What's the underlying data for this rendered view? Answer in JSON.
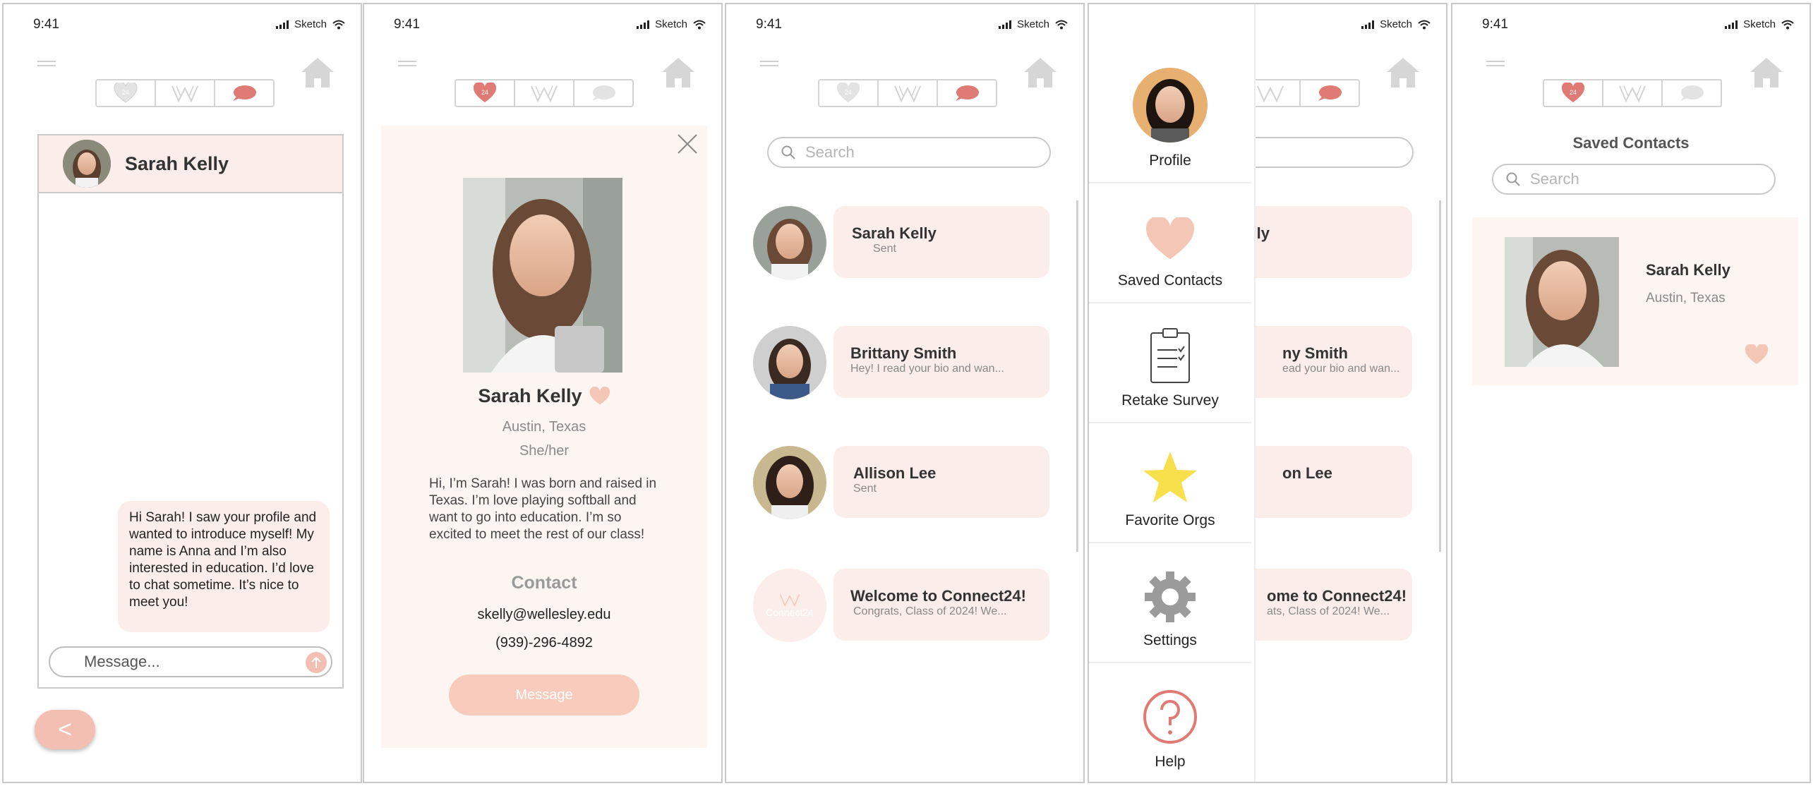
{
  "status": {
    "time": "9:41",
    "carrier": "Sketch"
  },
  "screen1": {
    "chat_name": "Sarah Kelly",
    "message": "Hi Sarah! I saw your profile and wanted to introduce myself! My name is Anna and I’m also interested in education. I’d love to chat sometime. It’s nice to meet you!",
    "input_placeholder": "Message...",
    "back_label": "<"
  },
  "screen2": {
    "name": "Sarah Kelly",
    "location": "Austin, Texas",
    "pronouns": "She/her",
    "bio": "Hi, I’m Sarah! I was born and raised in Texas. I’m love playing softball and want to go into education. I’m so excited to meet the rest of our class!",
    "contact_heading": "Contact",
    "email": "skelly@wellesley.edu",
    "phone": "(939)-296-4892",
    "message_button": "Message"
  },
  "screen3": {
    "search_placeholder": "Search",
    "conversations": [
      {
        "name": "Sarah Kelly",
        "preview": "Sent"
      },
      {
        "name": "Brittany Smith",
        "preview": "Hey! I read your bio and wan..."
      },
      {
        "name": "Allison Lee",
        "preview": "Sent"
      },
      {
        "name": "Welcome to Connect24!",
        "preview": "Congrats, Class of 2024! We...",
        "logo_text": "Connect24"
      }
    ]
  },
  "screen4": {
    "menu": [
      {
        "label": "Profile",
        "icon": "profile-photo"
      },
      {
        "label": "Saved Contacts",
        "icon": "heart-icon"
      },
      {
        "label": "Retake Survey",
        "icon": "clipboard-icon"
      },
      {
        "label": "Favorite Orgs",
        "icon": "star-icon"
      },
      {
        "label": "Settings",
        "icon": "gear-icon"
      },
      {
        "label": "Help",
        "icon": "help-icon"
      }
    ],
    "behind": {
      "conversations": [
        {
          "name": "n Kelly"
        },
        {
          "name": "ny Smith",
          "preview": "ead your bio and wan..."
        },
        {
          "name": "on Lee"
        },
        {
          "name": "ome to Connect24!",
          "preview": "ats, Class of 2024! We..."
        }
      ]
    }
  },
  "screen5": {
    "title": "Saved Contacts",
    "search_placeholder": "Search",
    "contact": {
      "name": "Sarah Kelly",
      "location": "Austin, Texas"
    }
  },
  "tabs": {
    "badge": "24"
  },
  "colors": {
    "pink": "#f3bfb2",
    "light_pink": "#fbeeea",
    "red": "#e07a75",
    "gray": "#d3d3d3",
    "star": "#f7e04b"
  }
}
